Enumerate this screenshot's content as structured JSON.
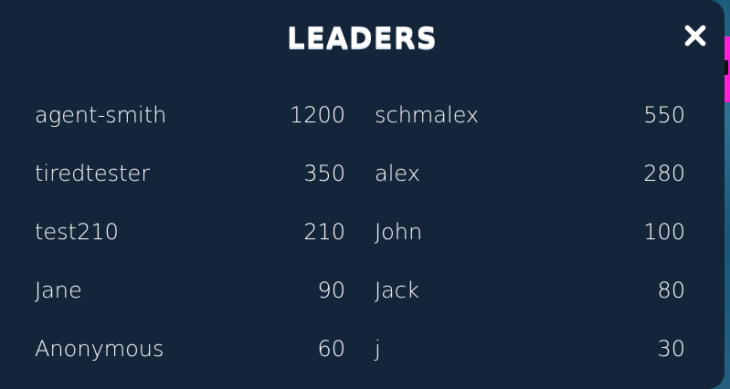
{
  "title": "LEADERS",
  "close_icon": "close-icon",
  "entries": [
    {
      "name": "agent-smith",
      "score": "1200"
    },
    {
      "name": "schmalex",
      "score": "550"
    },
    {
      "name": "tiredtester",
      "score": "350"
    },
    {
      "name": "alex",
      "score": "280"
    },
    {
      "name": "test210",
      "score": "210"
    },
    {
      "name": "John",
      "score": "100"
    },
    {
      "name": "Jane",
      "score": "90"
    },
    {
      "name": "Jack",
      "score": "80"
    },
    {
      "name": "Anonymous",
      "score": "60"
    },
    {
      "name": "j",
      "score": "30"
    }
  ],
  "colors": {
    "modal_bg": "#14253a",
    "text": "#ffffff",
    "accent": "#ff1ed7"
  }
}
